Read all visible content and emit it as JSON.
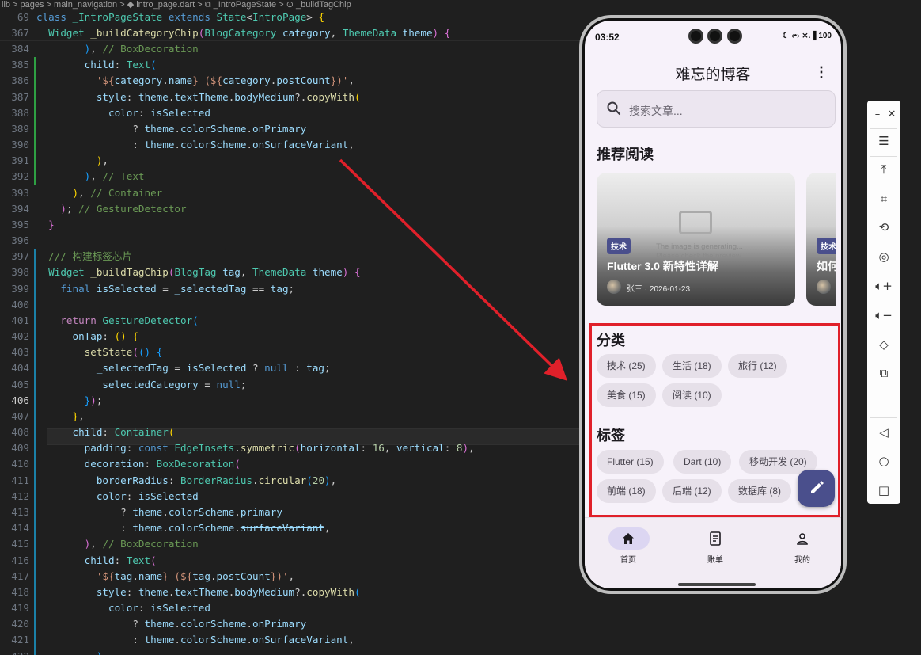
{
  "breadcrumb": "lib > pages > main_navigation > ◆ intro_page.dart > ⧉ _IntroPageState > ⊙ _buildTagChip",
  "sticky_lines": [
    {
      "num": "69",
      "html": "<span style='color:#569cd6'>class</span> <span style='color:#4ec9b0'>_IntroPageState</span> <span style='color:#569cd6'>extends</span> <span style='color:#4ec9b0'>State</span><span style='color:#d4d4d4'>&lt;</span><span style='color:#4ec9b0'>IntroPage</span><span style='color:#d4d4d4'>&gt;</span> <span style='color:#ffd700'>{</span>"
    },
    {
      "num": "367",
      "html": "  <span style='color:#4ec9b0'>Widget</span> <span style='color:#dcdcaa'>_buildCategoryChip</span><span style='color:#da70d6'>(</span><span style='color:#4ec9b0'>BlogCategory</span> <span style='color:#9cdcfe'>category</span>, <span style='color:#4ec9b0'>ThemeData</span> <span style='color:#9cdcfe'>theme</span><span style='color:#da70d6'>)</span> <span style='color:#da70d6'>{</span>"
    }
  ],
  "code_lines": [
    {
      "num": "384",
      "g": "",
      "html": "        <span style='color:#179fff'>)</span>, <span style='color:#6a9955'>// BoxDecoration</span>"
    },
    {
      "num": "385",
      "g": "add",
      "html": "        <span style='color:#9cdcfe'>child</span>: <span style='color:#4ec9b0'>Text</span><span style='color:#179fff'>(</span>"
    },
    {
      "num": "386",
      "g": "add",
      "html": "          <span style='color:#ce9178'>'${</span><span style='color:#9cdcfe'>category</span>.<span style='color:#9cdcfe'>name</span><span style='color:#ce9178'>} (${</span><span style='color:#9cdcfe'>category</span>.<span style='color:#9cdcfe'>postCount</span><span style='color:#ce9178'>})'</span>,"
    },
    {
      "num": "387",
      "g": "add",
      "html": "          <span style='color:#9cdcfe'>style</span>: <span style='color:#9cdcfe'>theme</span>.<span style='color:#9cdcfe'>textTheme</span>.<span style='color:#9cdcfe'>bodyMedium</span>?.<span style='color:#dcdcaa'>copyWith</span><span style='color:#ffd700'>(</span>"
    },
    {
      "num": "388",
      "g": "add",
      "html": "            <span style='color:#9cdcfe'>color</span>: <span style='color:#9cdcfe'>isSelected</span>"
    },
    {
      "num": "389",
      "g": "add",
      "html": "                ? <span style='color:#9cdcfe'>theme</span>.<span style='color:#9cdcfe'>colorScheme</span>.<span style='color:#9cdcfe'>onPrimary</span>"
    },
    {
      "num": "390",
      "g": "add",
      "html": "                : <span style='color:#9cdcfe'>theme</span>.<span style='color:#9cdcfe'>colorScheme</span>.<span style='color:#9cdcfe'>onSurfaceVariant</span>,"
    },
    {
      "num": "391",
      "g": "add",
      "html": "          <span style='color:#ffd700'>)</span>,"
    },
    {
      "num": "392",
      "g": "add",
      "html": "        <span style='color:#179fff'>)</span>, <span style='color:#6a9955'>// Text</span>"
    },
    {
      "num": "393",
      "g": "",
      "html": "      <span style='color:#ffd700'>)</span>, <span style='color:#6a9955'>// Container</span>"
    },
    {
      "num": "394",
      "g": "",
      "html": "    <span style='color:#da70d6'>)</span>; <span style='color:#6a9955'>// GestureDetector</span>"
    },
    {
      "num": "395",
      "g": "",
      "html": "  <span style='color:#da70d6'>}</span>"
    },
    {
      "num": "396",
      "g": "",
      "html": ""
    },
    {
      "num": "397",
      "g": "mod",
      "html": "  <span style='color:#6a9955'>/// 构建标签芯片</span>"
    },
    {
      "num": "398",
      "g": "mod",
      "html": "  <span style='color:#4ec9b0'>Widget</span> <span style='color:#dcdcaa'>_buildTagChip</span><span style='color:#da70d6'>(</span><span style='color:#4ec9b0'>BlogTag</span> <span style='color:#9cdcfe'>tag</span>, <span style='color:#4ec9b0'>ThemeData</span> <span style='color:#9cdcfe'>theme</span><span style='color:#da70d6'>)</span> <span style='color:#da70d6'>{</span>"
    },
    {
      "num": "399",
      "g": "mod",
      "html": "    <span style='color:#569cd6'>final</span> <span style='color:#9cdcfe'>isSelected</span> = <span style='color:#9cdcfe'>_selectedTag</span> == <span style='color:#9cdcfe'>tag</span>;"
    },
    {
      "num": "400",
      "g": "mod",
      "html": ""
    },
    {
      "num": "401",
      "g": "mod",
      "html": "    <span style='color:#c586c0'>return</span> <span style='color:#4ec9b0'>GestureDetector</span><span style='color:#179fff'>(</span>"
    },
    {
      "num": "402",
      "g": "mod",
      "html": "      <span style='color:#9cdcfe'>onTap</span>: <span style='color:#ffd700'>()</span> <span style='color:#ffd700'>{</span>"
    },
    {
      "num": "403",
      "g": "mod",
      "html": "        <span style='color:#dcdcaa'>setState</span><span style='color:#da70d6'>(</span><span style='color:#179fff'>()</span> <span style='color:#179fff'>{</span>"
    },
    {
      "num": "404",
      "g": "mod",
      "html": "          <span style='color:#9cdcfe'>_selectedTag</span> = <span style='color:#9cdcfe'>isSelected</span> ? <span style='color:#569cd6'>null</span> : <span style='color:#9cdcfe'>tag</span>;"
    },
    {
      "num": "405",
      "g": "mod",
      "html": "          <span style='color:#9cdcfe'>_selectedCategory</span> = <span style='color:#569cd6'>null</span>;"
    },
    {
      "num": "406",
      "g": "mod",
      "html": "        <span style='color:#179fff'>}</span><span style='color:#da70d6'>)</span>;"
    },
    {
      "num": "407",
      "g": "mod",
      "html": "      <span style='color:#ffd700'>}</span>,"
    },
    {
      "num": "408",
      "g": "mod",
      "html": "      <span style='color:#9cdcfe'>child</span>: <span style='color:#4ec9b0'>Container</span><span style='color:#ffd700'>(</span>"
    },
    {
      "num": "409",
      "g": "mod",
      "html": "        <span style='color:#9cdcfe'>padding</span>: <span style='color:#569cd6'>const</span> <span style='color:#4ec9b0'>EdgeInsets</span>.<span style='color:#dcdcaa'>symmetric</span><span style='color:#da70d6'>(</span><span style='color:#9cdcfe'>horizontal</span>: <span style='color:#b5cea8'>16</span>, <span style='color:#9cdcfe'>vertical</span>: <span style='color:#b5cea8'>8</span><span style='color:#da70d6'>)</span>,"
    },
    {
      "num": "410",
      "g": "mod",
      "html": "        <span style='color:#9cdcfe'>decoration</span>: <span style='color:#4ec9b0'>BoxDecoration</span><span style='color:#da70d6'>(</span>"
    },
    {
      "num": "411",
      "g": "mod",
      "html": "          <span style='color:#9cdcfe'>borderRadius</span>: <span style='color:#4ec9b0'>BorderRadius</span>.<span style='color:#dcdcaa'>circular</span><span style='color:#179fff'>(</span><span style='color:#b5cea8'>20</span><span style='color:#179fff'>)</span>,"
    },
    {
      "num": "412",
      "g": "mod",
      "html": "          <span style='color:#9cdcfe'>color</span>: <span style='color:#9cdcfe'>isSelected</span>"
    },
    {
      "num": "413",
      "g": "mod",
      "html": "              ? <span style='color:#9cdcfe'>theme</span>.<span style='color:#9cdcfe'>colorScheme</span>.<span style='color:#9cdcfe'>primary</span>"
    },
    {
      "num": "414",
      "g": "mod",
      "html": "              : <span style='color:#9cdcfe'>theme</span>.<span style='color:#9cdcfe'>colorScheme</span>.<span style='color:#9cdcfe' class='st sq'>surfaceVariant</span>,"
    },
    {
      "num": "415",
      "g": "mod",
      "html": "        <span style='color:#da70d6'>)</span>, <span style='color:#6a9955'>// BoxDecoration</span>"
    },
    {
      "num": "416",
      "g": "mod",
      "html": "        <span style='color:#9cdcfe'>child</span>: <span style='color:#4ec9b0'>Text</span><span style='color:#da70d6'>(</span>"
    },
    {
      "num": "417",
      "g": "mod",
      "html": "          <span style='color:#ce9178'>'${</span><span style='color:#9cdcfe'>tag</span>.<span style='color:#9cdcfe'>name</span><span style='color:#ce9178'>} (${</span><span style='color:#9cdcfe'>tag</span>.<span style='color:#9cdcfe'>postCount</span><span style='color:#ce9178'>})'</span>,"
    },
    {
      "num": "418",
      "g": "mod",
      "html": "          <span style='color:#9cdcfe'>style</span>: <span style='color:#9cdcfe'>theme</span>.<span style='color:#9cdcfe'>textTheme</span>.<span style='color:#9cdcfe'>bodyMedium</span>?.<span style='color:#dcdcaa'>copyWith</span><span style='color:#179fff'>(</span>"
    },
    {
      "num": "419",
      "g": "mod",
      "html": "            <span style='color:#9cdcfe'>color</span>: <span style='color:#9cdcfe'>isSelected</span>"
    },
    {
      "num": "420",
      "g": "mod",
      "html": "                ? <span style='color:#9cdcfe'>theme</span>.<span style='color:#9cdcfe'>colorScheme</span>.<span style='color:#9cdcfe'>onPrimary</span>"
    },
    {
      "num": "421",
      "g": "mod",
      "html": "                : <span style='color:#9cdcfe'>theme</span>.<span style='color:#9cdcfe'>colorScheme</span>.<span style='color:#9cdcfe'>onSurfaceVariant</span>,"
    },
    {
      "num": "422",
      "g": "mod",
      "html": "          <span style='color:#179fff'>)</span>,"
    }
  ],
  "current_line": "406",
  "phone": {
    "time": "03:52",
    "status_icons": "☾ ‹•› ⨯.▐ 100",
    "app_title": "难忘的博客",
    "search_placeholder": "搜索文章...",
    "recommended_title": "推荐阅读",
    "cards": [
      {
        "tag": "技术",
        "title": "Flutter 3.0 新特性详解",
        "author": "张三",
        "date": "2026-01-23",
        "generating_text": "The image is generating... Please check the preview."
      },
      {
        "tag": "技术",
        "title": "如何"
      }
    ],
    "category_title": "分类",
    "categories": [
      "技术 (25)",
      "生活 (18)",
      "旅行 (12)",
      "美食 (15)",
      "阅读 (10)"
    ],
    "tag_title": "标签",
    "tags": [
      "Flutter (15)",
      "Dart (10)",
      "移动开发 (20)",
      "前端 (18)",
      "后端 (12)",
      "数据库 (8)"
    ],
    "nav": [
      {
        "label": "首页",
        "icon": "home-icon"
      },
      {
        "label": "账单",
        "icon": "list-icon"
      },
      {
        "label": "我的",
        "icon": "person-icon"
      }
    ]
  },
  "colors": {
    "accent": "#4a4f8c",
    "annotation": "#e0202a",
    "editor_bg": "#1f1f1f"
  }
}
